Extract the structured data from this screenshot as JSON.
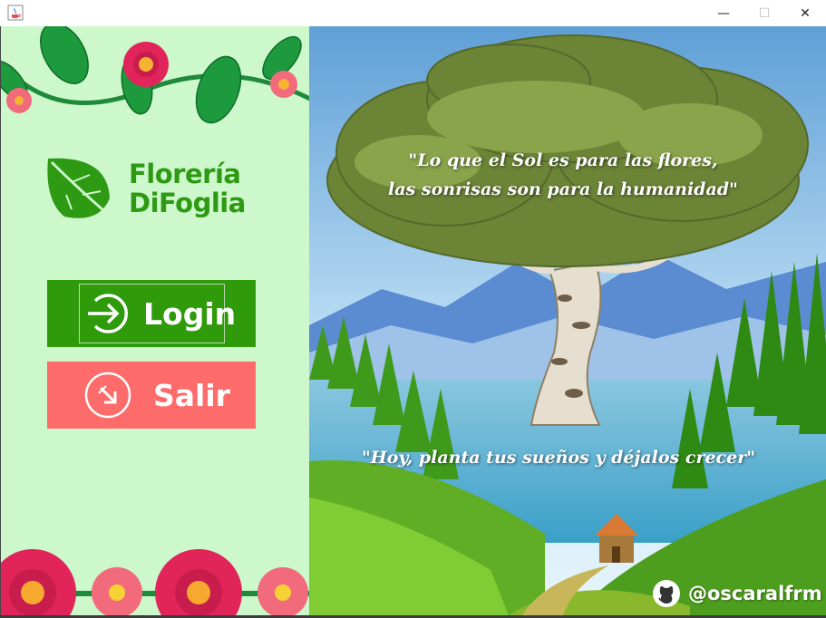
{
  "window": {
    "controls": {
      "minimize": "—",
      "maximize": "☐",
      "close": "✕"
    },
    "app_icon": "java-cup-icon"
  },
  "brand": {
    "line1": "Florería",
    "line2": "DiFoglia",
    "logo_icon": "leaf-icon",
    "color": "#2e9a14"
  },
  "buttons": {
    "login": {
      "label": "Login",
      "icon": "login-arrow-icon",
      "color": "#2f9a0a"
    },
    "salir": {
      "label": "Salir",
      "icon": "exit-arrow-icon",
      "color": "#fd6b6b"
    }
  },
  "quotes": {
    "top_line1": "\"Lo que el Sol es para las flores,",
    "top_line2": "las sonrisas son para la humanidad\"",
    "bottom": "\"Hoy, planta tus sueños y déjalos crecer\""
  },
  "footer": {
    "github_icon": "github-icon",
    "handle": "@oscaralfrm"
  },
  "colors": {
    "left_panel_bg": "#ccf8cc",
    "flower_pink": "#e1245a",
    "flower_light": "#f26b7d",
    "vine_green": "#1f8a3a"
  }
}
